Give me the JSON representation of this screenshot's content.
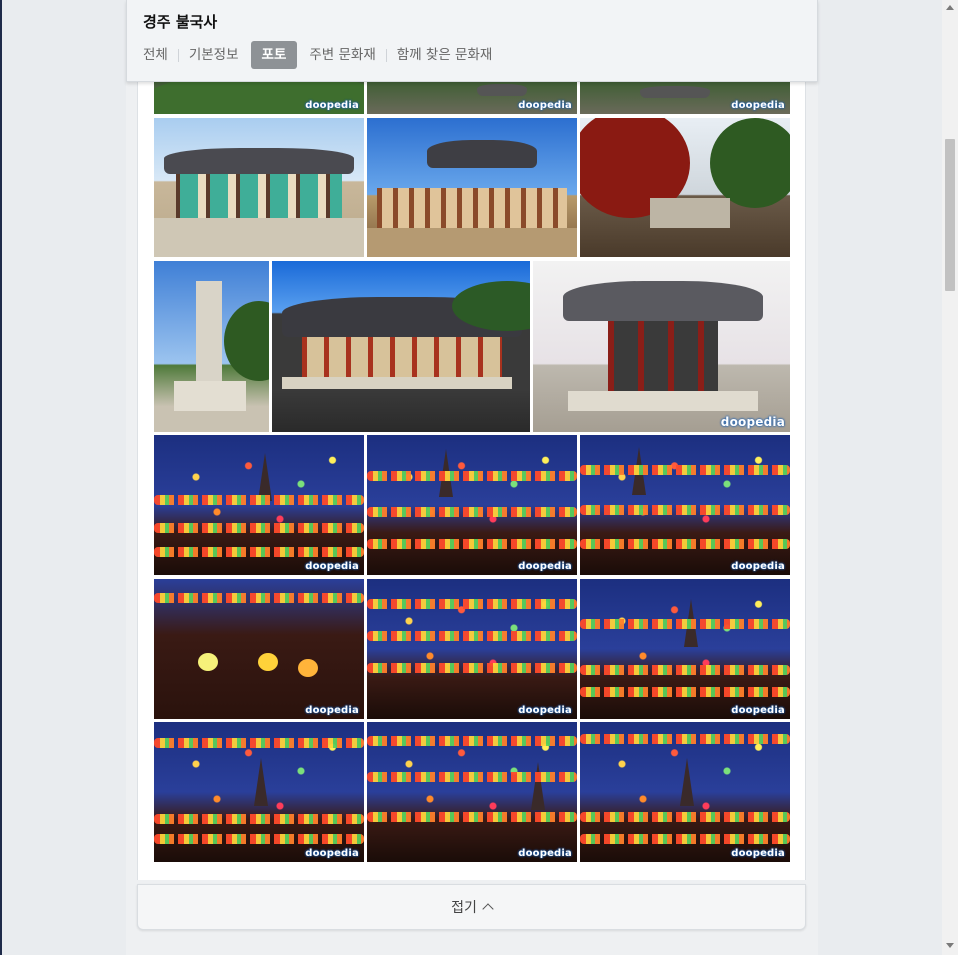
{
  "header": {
    "title": "경주 불국사",
    "tabs": [
      {
        "label": "전체"
      },
      {
        "label": "기본정보"
      },
      {
        "label": "포토",
        "active": true
      },
      {
        "label": "주변 문화재"
      },
      {
        "label": "함께 찾은 문화재"
      }
    ]
  },
  "gallery": {
    "watermark": "doopedia",
    "photos": [
      {
        "scene": "forest"
      },
      {
        "scene": "forest"
      },
      {
        "scene": "forest"
      },
      {
        "scene": "temple-hall-day"
      },
      {
        "scene": "temple-pavilion-day"
      },
      {
        "scene": "autumn-temple"
      },
      {
        "scene": "stone-pagoda"
      },
      {
        "scene": "main-hall"
      },
      {
        "scene": "bell-pavilion"
      },
      {
        "scene": "lantern-night"
      },
      {
        "scene": "lantern-night"
      },
      {
        "scene": "lantern-night"
      },
      {
        "scene": "lantern-night-people"
      },
      {
        "scene": "lantern-night"
      },
      {
        "scene": "lantern-night"
      },
      {
        "scene": "lantern-night"
      },
      {
        "scene": "lantern-night"
      },
      {
        "scene": "lantern-night"
      }
    ]
  },
  "footer": {
    "collapse_label": "접기"
  },
  "colors": {
    "active_tab_bg": "#8e9296",
    "watermark_glow": "#1a5fb4"
  }
}
